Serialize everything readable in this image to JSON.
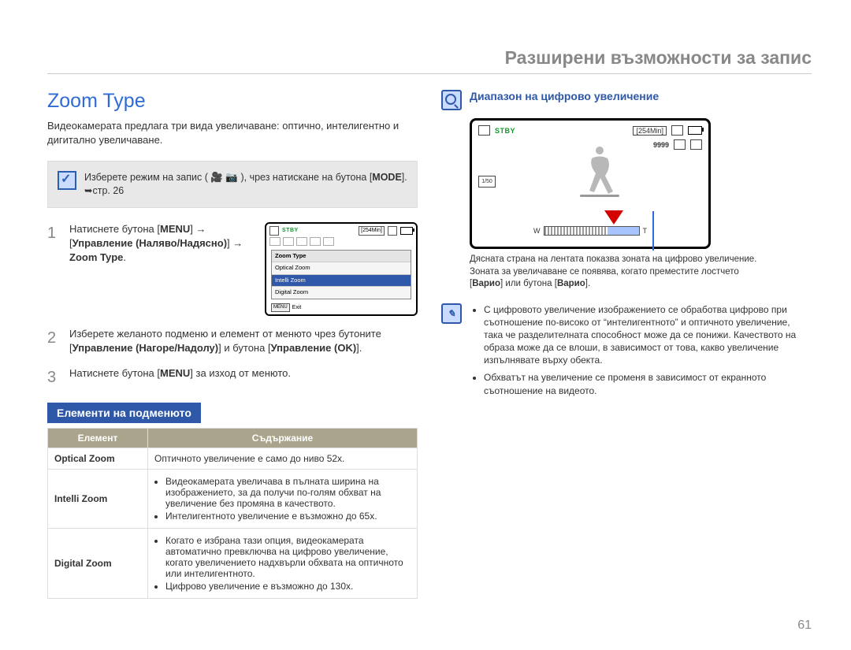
{
  "header": {
    "title": "Разширени възможности за запис"
  },
  "left": {
    "title": "Zoom Type",
    "intro": "Видеокамерата предлага три вида увеличаване: оптично, интелигентно и дигитално увеличаване.",
    "callout_pre": "Изберете режим на запис ( ",
    "callout_post": " ), чрез натискане на бутона ",
    "callout_mode": "MODE",
    "callout_page_ref": ". ➥стр. 26",
    "step1_a": "Натиснете бутона [",
    "step1_b": "MENU",
    "step1_c": "] → [",
    "step1_d": "Управление (Наляво/Надясно)",
    "step1_e": "] → ",
    "step1_f": "Zoom Type",
    "step1_g": ".",
    "step2_a": "Изберете желаното подменю и елемент от менюто чрез бутоните [",
    "step2_b": "Управление (Нагоре/Надолу)",
    "step2_c": "] и бутона [",
    "step2_d": "Управление (OK)",
    "step2_e": "].",
    "step3_a": "Натиснете бутона [",
    "step3_b": "MENU",
    "step3_c": "] за изход от менюто.",
    "mini": {
      "stby": "STBY",
      "time": "[254Min]",
      "menu_title": "Zoom Type",
      "opt1": "Optical Zoom",
      "opt2": "Intelli Zoom",
      "opt3": "Digital Zoom",
      "menu_btn": "MENU",
      "exit": "Exit"
    },
    "sub_title": "Елементи на подменюто",
    "table": {
      "h_item": "Елемент",
      "h_content": "Съдържание",
      "r1_name": "Optical Zoom",
      "r1_txt": "Оптичното увеличение е само до ниво 52x.",
      "r2_name": "Intelli Zoom",
      "r2_b1": "Видеокамерата увеличава в пълната ширина на изображението, за да получи по-голям обхват на увеличение без промяна в качеството.",
      "r2_b2": "Интелигентното увеличение е възможно до 65x.",
      "r3_name": "Digital Zoom",
      "r3_b1": "Когато е избрана тази опция, видеокамерата автоматично превключва на цифрово увеличение, когато увеличението надхвърли обхвата на оптичното или интелигентното.",
      "r3_b2": "Цифрово увеличение е възможно до 130x."
    }
  },
  "right": {
    "feature_title": "Диапазон на цифрово увеличение",
    "preview": {
      "stby": "STBY",
      "time": "[254Min]",
      "n9999": "9999",
      "sd": "SD",
      "aspect": "1/50",
      "W": "W",
      "T": "T"
    },
    "caption_l1": "Дясната страна на лентата показва зоната на цифрово увеличение.",
    "caption_l2_a": "Зоната за увеличаване се появява, когато преместите лостчето [",
    "caption_l2_b": "Варио",
    "caption_l2_c": "] или бутона [",
    "caption_l2_d": "Варио",
    "caption_l2_e": "].",
    "notes": {
      "n1": "С цифровото увеличение изображението се обработва цифрово при съотношение по-високо от “интелигентното” и оптичното увеличение, така че разделителната способност може да се понижи. Качеството на образа може да се влоши, в зависимост от това, какво увеличение изпълнявате върху обекта.",
      "n2": "Обхватът на увеличение се променя в зависимост от екранното съотношение на видеото."
    }
  },
  "page_number": "61"
}
